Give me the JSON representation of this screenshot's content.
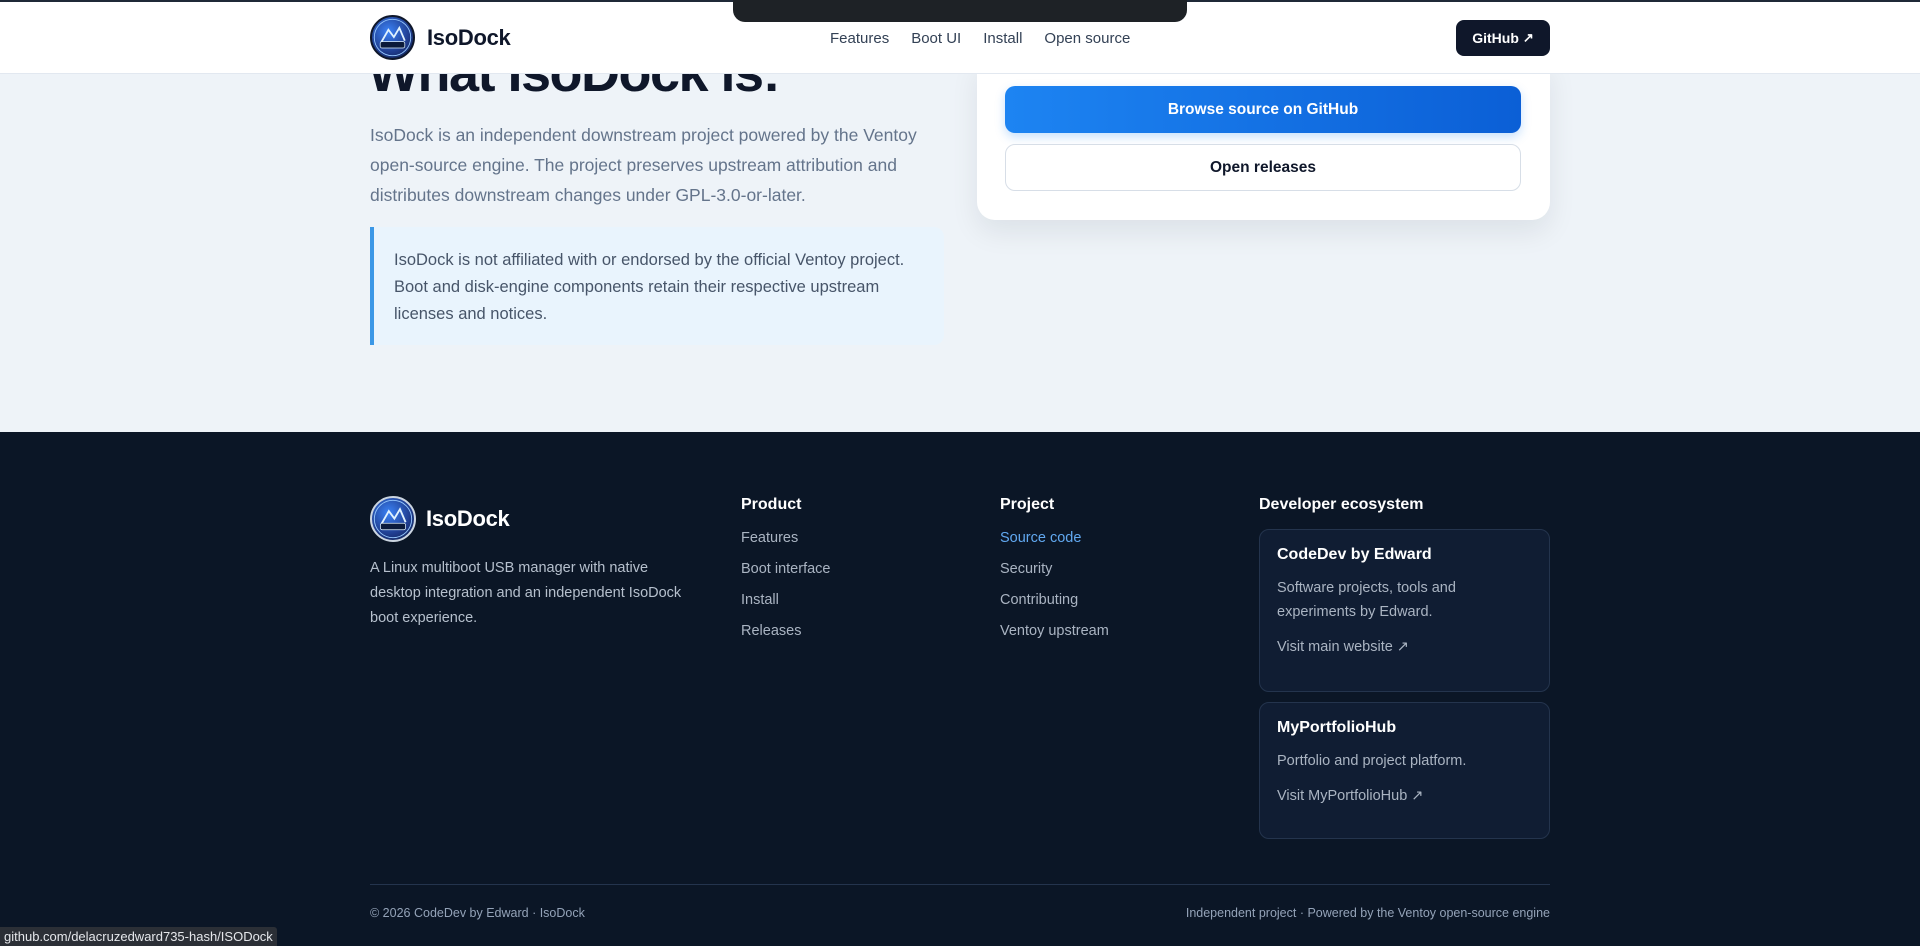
{
  "header": {
    "brand": "IsoDock",
    "nav": [
      "Features",
      "Boot UI",
      "Install",
      "Open source"
    ],
    "github_label": "GitHub",
    "github_arrow": "↗"
  },
  "about": {
    "title": "What IsoDock is:",
    "description": "IsoDock is an independent downstream project powered by the Ventoy open-source engine. The project preserves upstream attribution and distributes downstream changes under GPL-3.0-or-later.",
    "notice": "IsoDock is not affiliated with or endorsed by the official Ventoy project. Boot and disk-engine components retain their respective upstream licenses and notices."
  },
  "card": {
    "primary_label": "Browse source on GitHub",
    "secondary_label": "Open releases"
  },
  "footer": {
    "brand": "IsoDock",
    "tagline": "A Linux multiboot USB manager with native desktop integration and an independent IsoDock boot experience.",
    "product": {
      "title": "Product",
      "links": [
        "Features",
        "Boot interface",
        "Install",
        "Releases"
      ]
    },
    "project": {
      "title": "Project",
      "links": [
        "Source code",
        "Security",
        "Contributing",
        "Ventoy upstream"
      ]
    },
    "ecosystem": {
      "title": "Developer ecosystem",
      "cards": [
        {
          "title": "CodeDev by Edward",
          "desc": "Software projects, tools and experiments by Edward.",
          "link": "Visit main website ↗"
        },
        {
          "title": "MyPortfolioHub",
          "desc": "Portfolio and project platform.",
          "link": "Visit MyPortfolioHub ↗"
        }
      ]
    },
    "copyright": "© 2026 CodeDev by Edward · IsoDock",
    "right_text": "Independent project · Powered by the Ventoy open-source engine"
  },
  "status_url": "github.com/delacruzedward735-hash/ISODock",
  "colors": {
    "accent": "#1d84f2",
    "footer_bg": "#0b1626",
    "link_active": "#61a8f0",
    "notice_border": "#3b97e6"
  }
}
